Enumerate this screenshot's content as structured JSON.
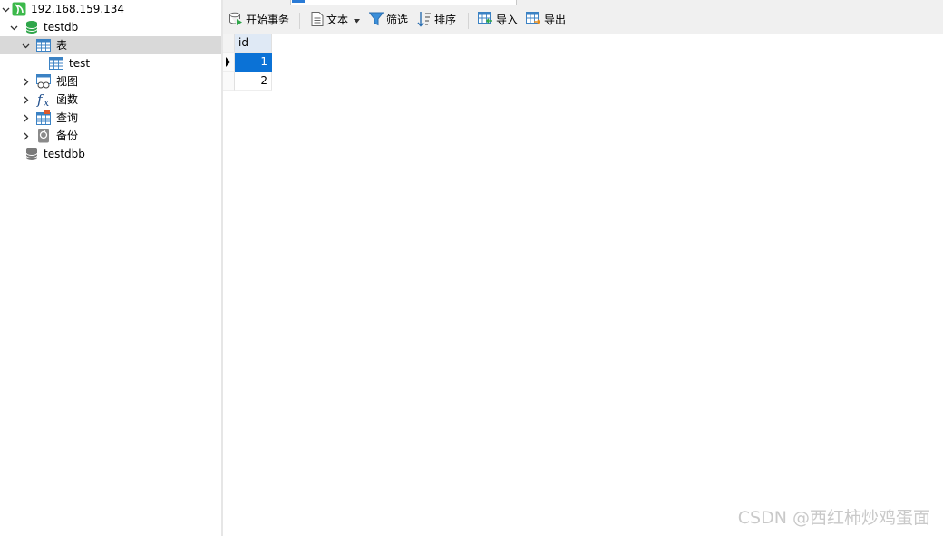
{
  "sidebar": {
    "connection": {
      "label": "192.168.159.134",
      "icon": "connection-icon",
      "color": "#3cb94b"
    },
    "databases": [
      {
        "label": "testdb",
        "icon": "database-icon",
        "color": "#2fa64a"
      },
      {
        "label": "testdbb",
        "icon": "database-icon",
        "color": "#7a7a7a"
      }
    ],
    "folders": {
      "tables": {
        "label": "表",
        "icon": "table-icon"
      },
      "tables_children": [
        {
          "label": "test",
          "icon": "table-icon"
        }
      ],
      "views": {
        "label": "视图",
        "icon": "view-icon"
      },
      "functions": {
        "label": "函数",
        "icon": "function-icon"
      },
      "queries": {
        "label": "查询",
        "icon": "query-icon"
      },
      "backups": {
        "label": "备份",
        "icon": "backup-icon"
      }
    },
    "selected_color": "#d9d9d9"
  },
  "toolbar": {
    "begin_transaction": "开始事务",
    "text": "文本",
    "filter": "筛选",
    "sort": "排序",
    "import": "导入",
    "export": "导出"
  },
  "grid": {
    "columns": [
      "id"
    ],
    "rows": [
      [
        "1"
      ],
      [
        "2"
      ]
    ],
    "selected_row": 0,
    "selection_color": "#0b72d6",
    "header_color": "#dfe9f5"
  },
  "watermark": "CSDN @西红柿炒鸡蛋面"
}
